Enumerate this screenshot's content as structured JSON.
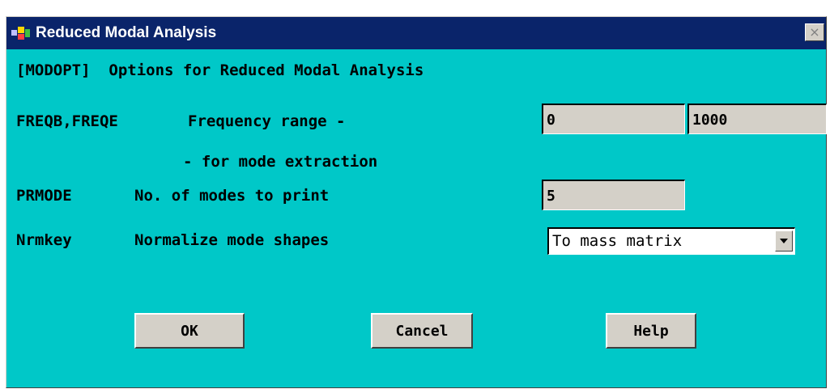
{
  "window": {
    "title": "Reduced Modal Analysis",
    "close_symbol": "×",
    "background_color": "#00c8c8",
    "titlebar_color": "#0a246a"
  },
  "header": {
    "text": "[MODOPT]  Options for Reduced Modal Analysis"
  },
  "rows": {
    "freq": {
      "key": "FREQB,FREQE",
      "label": "Frequency range -",
      "sublabel": "- for mode extraction",
      "value_begin": "0",
      "value_end": "1000"
    },
    "prmode": {
      "key": "PRMODE",
      "label": "No. of modes to print",
      "value": "5"
    },
    "nrmkey": {
      "key": "Nrmkey",
      "label": "Normalize mode shapes",
      "selected": "To mass matrix"
    }
  },
  "buttons": {
    "ok": "OK",
    "cancel": "Cancel",
    "help": "Help"
  },
  "icons": {
    "app": "ansys-app-icon",
    "close": "close-icon",
    "dropdown": "chevron-down-icon"
  }
}
